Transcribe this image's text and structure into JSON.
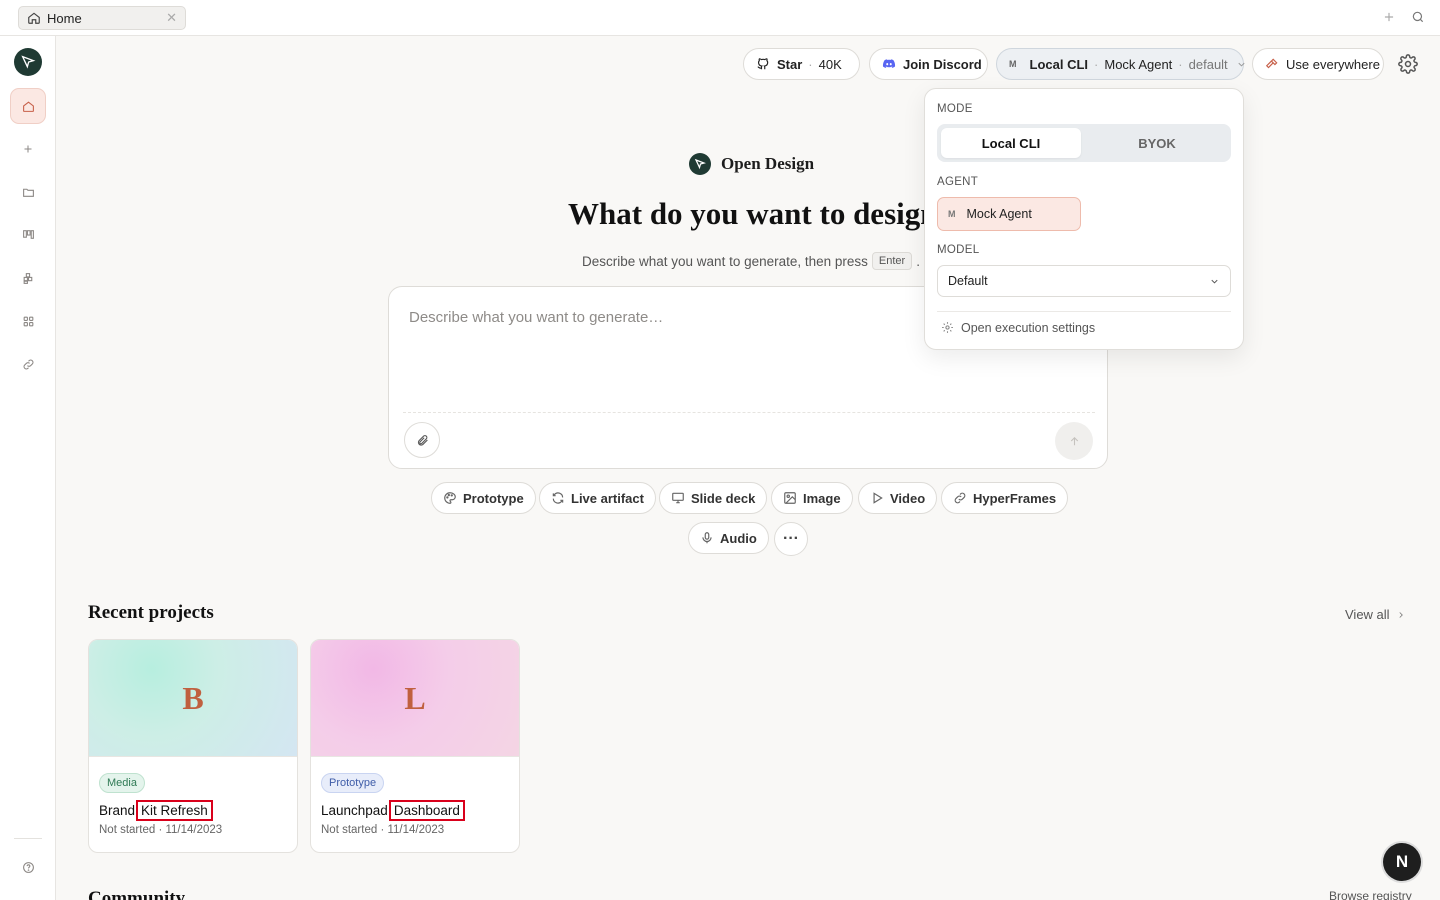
{
  "tab": {
    "label": "Home",
    "icon": "home-icon"
  },
  "header": {
    "star": {
      "label": "Star",
      "count": "40K"
    },
    "discord": {
      "label": "Join Discord"
    },
    "agent_pill": {
      "mode": "Local CLI",
      "agent": "Mock Agent",
      "model": "default"
    },
    "use_everywhere": "Use everywhere"
  },
  "hero": {
    "brand": "Open Design",
    "headline": "What do you want to design?",
    "subline": "Describe what you want to generate, then press",
    "kbd": "Enter",
    "subline_end": ".",
    "placeholder": "Describe what you want to generate…"
  },
  "chips": [
    "Prototype",
    "Live artifact",
    "Slide deck",
    "Image",
    "Video",
    "HyperFrames",
    "Audio"
  ],
  "recent": {
    "title": "Recent projects",
    "view_all": "View all",
    "projects": [
      {
        "initial": "B",
        "badge": "Media",
        "title_start": "Brand",
        "title_highlight": "Kit Refresh",
        "status": "Not started",
        "date": "11/14/2023"
      },
      {
        "initial": "L",
        "badge": "Prototype",
        "title_start": "Launchpad",
        "title_highlight": "Dashboard",
        "status": "Not started",
        "date": "11/14/2023"
      }
    ]
  },
  "community": {
    "title": "Community",
    "browse": "Browse registry"
  },
  "popover": {
    "mode_label": "MODE",
    "modes": [
      "Local CLI",
      "BYOK"
    ],
    "agent_label": "AGENT",
    "agent_badge": "M",
    "agent": "Mock Agent",
    "model_label": "MODEL",
    "model": "Default",
    "exec_settings": "Open execution settings"
  },
  "fab_label": "N",
  "colors": {
    "accent": "#c7604a",
    "logo_bg": "#1f3a33",
    "highlight_box": "#d9001b"
  }
}
